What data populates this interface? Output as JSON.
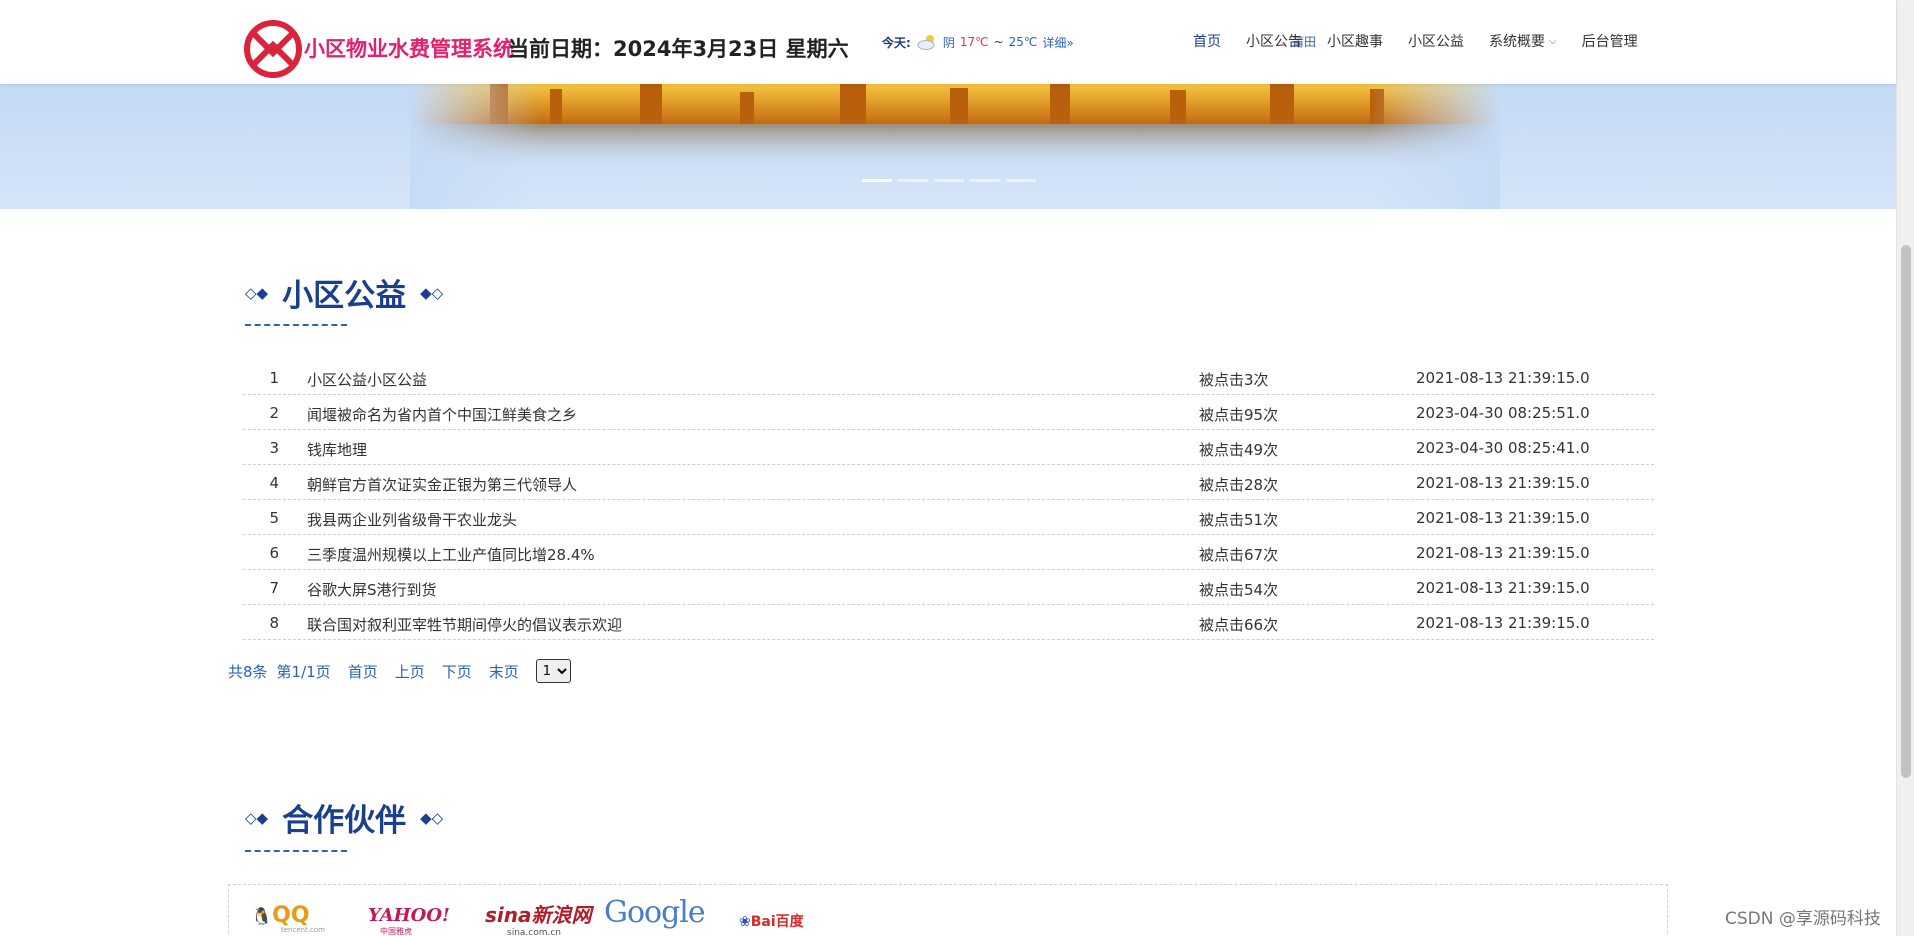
{
  "header": {
    "site_title": "小区物业水费管理系统",
    "date_text": "当前日期：2024年3月23日 星期六",
    "weather": {
      "label": "今天:",
      "city": "莆田",
      "icon": "cloud-sun-icon",
      "condition": "阴",
      "high": "17℃",
      "separator": "~",
      "low": "25℃",
      "more": "详细»"
    },
    "nav": [
      {
        "label": "首页",
        "active": true
      },
      {
        "label": "小区公告"
      },
      {
        "label": "小区趣事"
      },
      {
        "label": "小区公益"
      },
      {
        "label": "系统概要",
        "dropdown": true
      },
      {
        "label": "后台管理"
      }
    ]
  },
  "banner": {
    "slides": 5,
    "active_slide": 1
  },
  "section1": {
    "title": "小区公益",
    "deco_left": "◇◆",
    "deco_right": "◆◇"
  },
  "list": [
    {
      "num": "1",
      "title": "小区公益小区公益",
      "clicks": "被点击3次",
      "time": "2021-08-13 21:39:15.0"
    },
    {
      "num": "2",
      "title": "闻堰被命名为省内首个中国江鲜美食之乡",
      "clicks": "被点击95次",
      "time": "2023-04-30 08:25:51.0"
    },
    {
      "num": "3",
      "title": "钱库地理",
      "clicks": "被点击49次",
      "time": "2023-04-30 08:25:41.0"
    },
    {
      "num": "4",
      "title": "朝鲜官方首次证实金正银为第三代领导人",
      "clicks": "被点击28次",
      "time": "2021-08-13 21:39:15.0"
    },
    {
      "num": "5",
      "title": "我县两企业列省级骨干农业龙头",
      "clicks": "被点击51次",
      "time": "2021-08-13 21:39:15.0"
    },
    {
      "num": "6",
      "title": "三季度温州规模以上工业产值同比增28.4%",
      "clicks": "被点击67次",
      "time": "2021-08-13 21:39:15.0"
    },
    {
      "num": "7",
      "title": "谷歌大屏S港行到货",
      "clicks": "被点击54次",
      "time": "2021-08-13 21:39:15.0"
    },
    {
      "num": "8",
      "title": "联合国对叙利亚宰牲节期间停火的倡议表示欢迎",
      "clicks": "被点击66次",
      "time": "2021-08-13 21:39:15.0"
    }
  ],
  "pager": {
    "total": "共8条",
    "page": "第1/1页",
    "first": "首页",
    "prev": "上页",
    "next": "下页",
    "last": "末页",
    "select_value": "1"
  },
  "section2": {
    "title": "合作伙伴",
    "deco_left": "◇◆",
    "deco_right": "◆◇"
  },
  "partners": [
    {
      "name": "QQ",
      "sub": "tencent.com"
    },
    {
      "name": "YAHOO!",
      "sub": "中国雅虎"
    },
    {
      "name": "sina新浪网",
      "sub": "sina.com.cn"
    },
    {
      "name": "Google"
    },
    {
      "name": "Bai百度"
    }
  ],
  "watermark": "CSDN @享源码科技",
  "colors": {
    "brand_pink": "#e2206d",
    "nav_active": "#1a3f8c",
    "link_blue": "#2a64b4"
  }
}
